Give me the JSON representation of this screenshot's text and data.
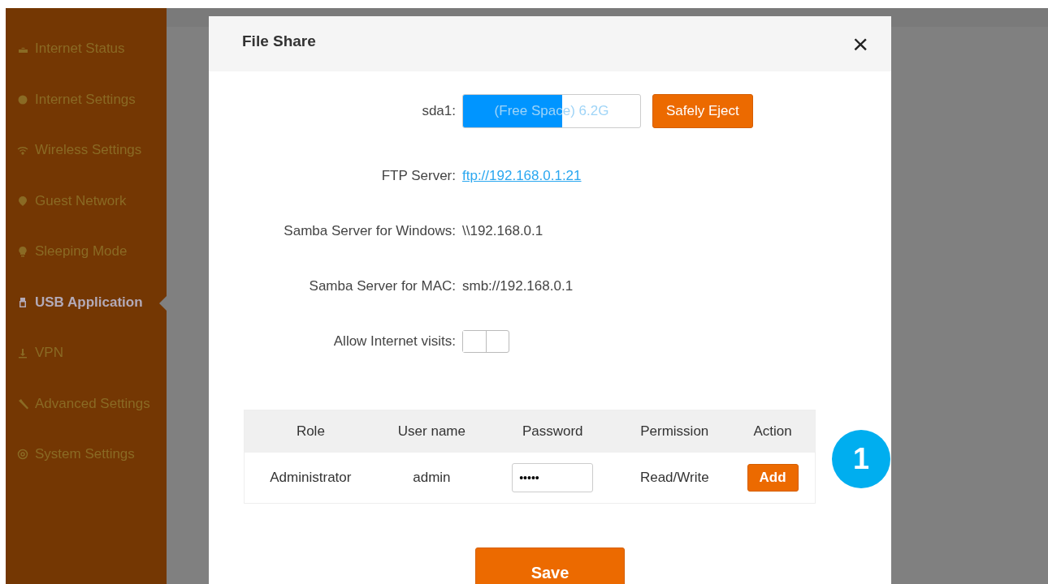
{
  "sidebar": {
    "items": [
      {
        "label": "Internet Status",
        "selected": false
      },
      {
        "label": "Internet Settings",
        "selected": false
      },
      {
        "label": "Wireless Settings",
        "selected": false
      },
      {
        "label": "Guest Network",
        "selected": false
      },
      {
        "label": "Sleeping Mode",
        "selected": false
      },
      {
        "label": "USB Application",
        "selected": true
      },
      {
        "label": "VPN",
        "selected": false
      },
      {
        "label": "Advanced Settings",
        "selected": false
      },
      {
        "label": "System Settings",
        "selected": false
      }
    ]
  },
  "dialog": {
    "title": "File Share",
    "close": "×",
    "storage": {
      "label": "sda1:",
      "text": "(Free Space) 6.2G",
      "level": 0.56,
      "button": "Safely Eject"
    },
    "fields": [
      {
        "label": "FTP Server:",
        "value": "ftp://192.168.0.1:21",
        "kind": "link"
      },
      {
        "label": "Samba Server for Windows:",
        "value": "\\\\192.168.0.1",
        "kind": "text"
      },
      {
        "label": "Samba Server for MAC:",
        "value": "smb://192.168.0.1",
        "kind": "text"
      }
    ],
    "internet": {
      "label": "Allow Internet visits:",
      "on": false
    },
    "table": {
      "columns": [
        "Role",
        "User name",
        "Password",
        "Permission",
        "Action"
      ],
      "rows": [
        {
          "role": "Administrator",
          "username": "admin",
          "password": "•••••",
          "permission": "Read/Write",
          "action": "Add"
        }
      ]
    },
    "save": "Save"
  },
  "callout": "1"
}
